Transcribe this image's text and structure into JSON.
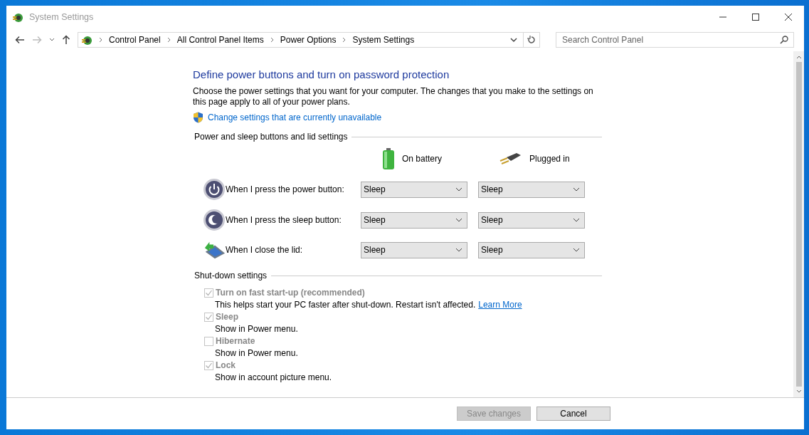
{
  "window": {
    "title": "System Settings"
  },
  "address_bar": {
    "breadcrumb": [
      "Control Panel",
      "All Control Panel Items",
      "Power Options",
      "System Settings"
    ]
  },
  "search": {
    "placeholder": "Search Control Panel"
  },
  "heading": "Define power buttons and turn on password protection",
  "description": "Choose the power settings that you want for your computer. The changes that you make to the settings on this page apply to all of your power plans.",
  "admin_link": "Change settings that are currently unavailable",
  "power_section": {
    "title": "Power and sleep buttons and lid settings",
    "columns": [
      {
        "label": "On battery",
        "kind": "battery"
      },
      {
        "label": "Plugged in",
        "kind": "plug"
      }
    ],
    "rows": [
      {
        "label": "When I press the power button:",
        "kind": "power",
        "values": [
          "Sleep",
          "Sleep"
        ]
      },
      {
        "label": "When I press the sleep button:",
        "kind": "sleep",
        "values": [
          "Sleep",
          "Sleep"
        ]
      },
      {
        "label": "When I close the lid:",
        "kind": "lid",
        "values": [
          "Sleep",
          "Sleep"
        ]
      }
    ]
  },
  "shutdown_section": {
    "title": "Shut-down settings",
    "options": [
      {
        "label": "Turn on fast start-up (recommended)",
        "checked": true,
        "disabled": true,
        "description": "This helps start your PC faster after shut-down. Restart isn't affected.",
        "link": "Learn More"
      },
      {
        "label": "Sleep",
        "checked": true,
        "disabled": true,
        "description": "Show in Power menu."
      },
      {
        "label": "Hibernate",
        "checked": false,
        "disabled": true,
        "description": "Show in Power menu."
      },
      {
        "label": "Lock",
        "checked": true,
        "disabled": true,
        "description": "Show in account picture menu."
      }
    ]
  },
  "buttons": [
    {
      "label": "Save changes",
      "disabled": true
    },
    {
      "label": "Cancel",
      "disabled": false
    }
  ]
}
